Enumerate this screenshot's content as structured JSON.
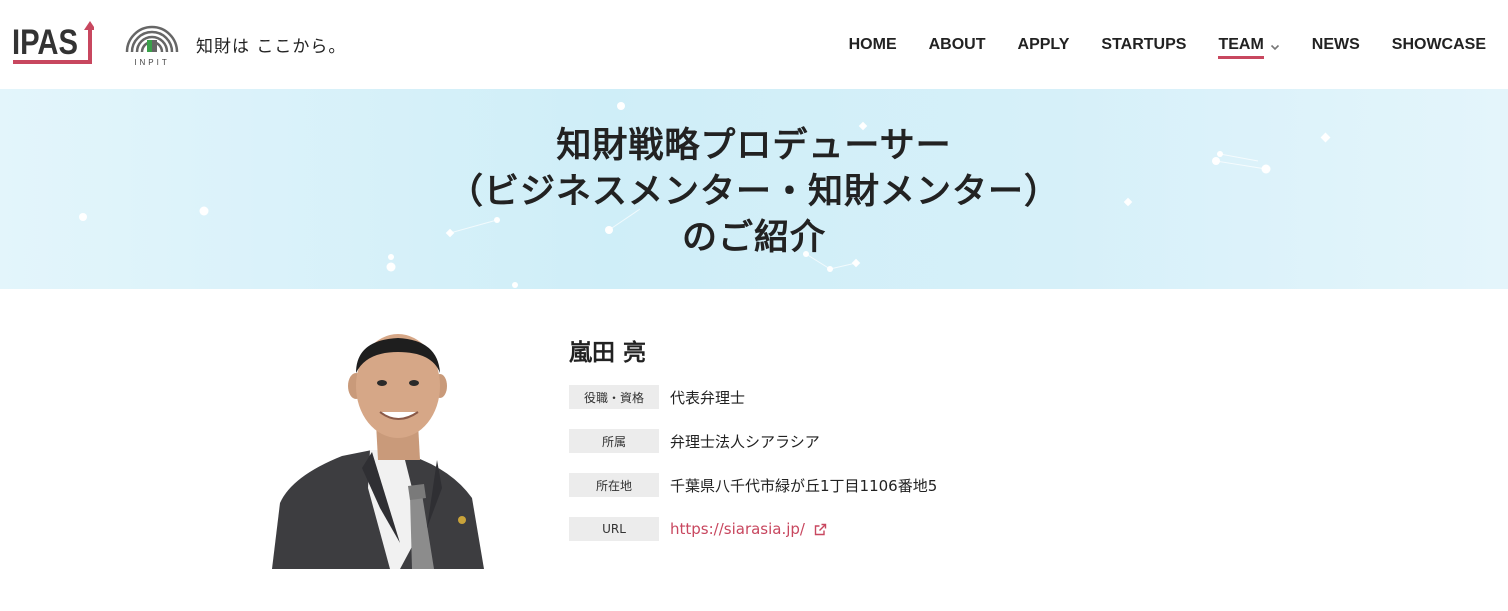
{
  "header": {
    "logo_ipas": "IPAS",
    "logo_inpit": "INPIT",
    "tagline": "知財は ここから。"
  },
  "nav": {
    "items": [
      {
        "label": "HOME"
      },
      {
        "label": "ABOUT"
      },
      {
        "label": "APPLY"
      },
      {
        "label": "STARTUPS"
      },
      {
        "label": "TEAM",
        "active": true,
        "dropdown": true
      },
      {
        "label": "NEWS"
      },
      {
        "label": "SHOWCASE"
      }
    ]
  },
  "hero": {
    "title_line1": "知財戦略プロデューサー",
    "title_line2": "（ビジネスメンター・知財メンター）",
    "title_line3": "のご紹介"
  },
  "profile": {
    "name": "嵐田 亮",
    "fields": [
      {
        "label": "役職・資格",
        "value": "代表弁理士"
      },
      {
        "label": "所属",
        "value": "弁理士法人シアラシア"
      },
      {
        "label": "所在地",
        "value": "千葉県八千代市緑が丘1丁目1106番地5"
      },
      {
        "label": "URL",
        "value": "https://siarasia.jp/"
      }
    ]
  },
  "colors": {
    "accent": "#c8475f",
    "hero_bg": "#d6f0f9",
    "label_bg": "#ececec"
  },
  "icons": {
    "dropdown": "chevron-down-icon",
    "external_link": "external-link-icon"
  }
}
